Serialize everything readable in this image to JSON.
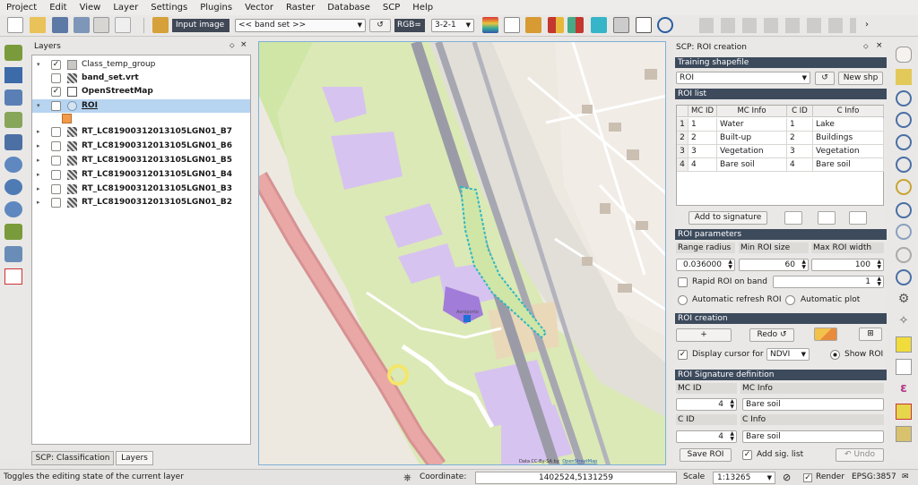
{
  "menu": [
    "Project",
    "Edit",
    "View",
    "Layer",
    "Settings",
    "Plugins",
    "Vector",
    "Raster",
    "Database",
    "SCP",
    "Help"
  ],
  "toolbar": {
    "input_image": "Input image",
    "band_set": "<< band set >>",
    "rgb": "RGB=",
    "rgb_value": "3-2-1"
  },
  "layers_panel": {
    "title": "Layers",
    "items": [
      {
        "label": "Class_temp_group",
        "checked": true,
        "bold": false
      },
      {
        "label": "band_set.vrt",
        "checked": false,
        "bold": true
      },
      {
        "label": "OpenStreetMap",
        "checked": true,
        "bold": true
      },
      {
        "label": "ROI",
        "checked": false,
        "bold": true,
        "selected": true
      },
      {
        "label": "RT_LC81900312013105LGN01_B7",
        "checked": false,
        "bold": true
      },
      {
        "label": "RT_LC81900312013105LGN01_B6",
        "checked": false,
        "bold": true
      },
      {
        "label": "RT_LC81900312013105LGN01_B5",
        "checked": false,
        "bold": true
      },
      {
        "label": "RT_LC81900312013105LGN01_B4",
        "checked": false,
        "bold": true
      },
      {
        "label": "RT_LC81900312013105LGN01_B3",
        "checked": false,
        "bold": true
      },
      {
        "label": "RT_LC81900312013105LGN01_B2",
        "checked": false,
        "bold": true
      }
    ],
    "tabs": [
      "SCP: Classification",
      "Layers"
    ]
  },
  "map": {
    "attribution_prefix": "Data CC-By-SA by",
    "attribution_link": "OpenStreetMap"
  },
  "scp": {
    "title": "SCP: ROI creation",
    "training_shapefile": {
      "header": "Training shapefile",
      "value": "ROI",
      "new_shp": "New shp"
    },
    "roi_list": {
      "header": "ROI list",
      "columns": [
        "MC ID",
        "MC Info",
        "C ID",
        "C Info"
      ],
      "rows": [
        [
          "1",
          "1",
          "Water",
          "1",
          "Lake"
        ],
        [
          "2",
          "2",
          "Built-up",
          "2",
          "Buildings"
        ],
        [
          "3",
          "3",
          "Vegetation",
          "3",
          "Vegetation"
        ],
        [
          "4",
          "4",
          "Bare soil",
          "4",
          "Bare soil"
        ]
      ],
      "add_to_signature": "Add to signature"
    },
    "roi_parameters": {
      "header": "ROI parameters",
      "range_radius_label": "Range radius",
      "min_roi_size_label": "Min ROI size",
      "max_roi_width_label": "Max ROI width",
      "range_radius": "0.036000",
      "min_roi_size": "60",
      "max_roi_width": "100",
      "rapid_roi_label": "Rapid ROI on band",
      "rapid_roi_band": "1",
      "auto_refresh_label": "Automatic refresh ROI",
      "auto_plot_label": "Automatic  plot"
    },
    "roi_creation": {
      "header": "ROI creation",
      "plus": "+",
      "redo": "Redo",
      "display_cursor_label": "Display cursor for",
      "cursor_index": "NDVI",
      "show_roi": "Show ROI"
    },
    "signature_definition": {
      "header": "ROI Signature definition",
      "mc_id_label": "MC ID",
      "mc_info_label": "MC Info",
      "mc_id": "4",
      "mc_info": "Bare soil",
      "c_id_label": "C ID",
      "c_info_label": "C Info",
      "c_id": "4",
      "c_info": "Bare soil",
      "save_roi": "Save ROI",
      "add_sig_list": "Add sig. list",
      "undo": "Undo"
    }
  },
  "status": {
    "message": "Toggles the editing state of the current layer",
    "coordinate_label": "Coordinate:",
    "coordinate": "1402524,5131259",
    "scale_label": "Scale",
    "scale": "1:13265",
    "render_label": "Render",
    "crs": "EPSG:3857"
  },
  "colors": {
    "accent": "#3c4a5c",
    "selection": "#b7d4f0",
    "roi_outline": "#2fb7c4",
    "roi_fill": "#f29a4a"
  }
}
